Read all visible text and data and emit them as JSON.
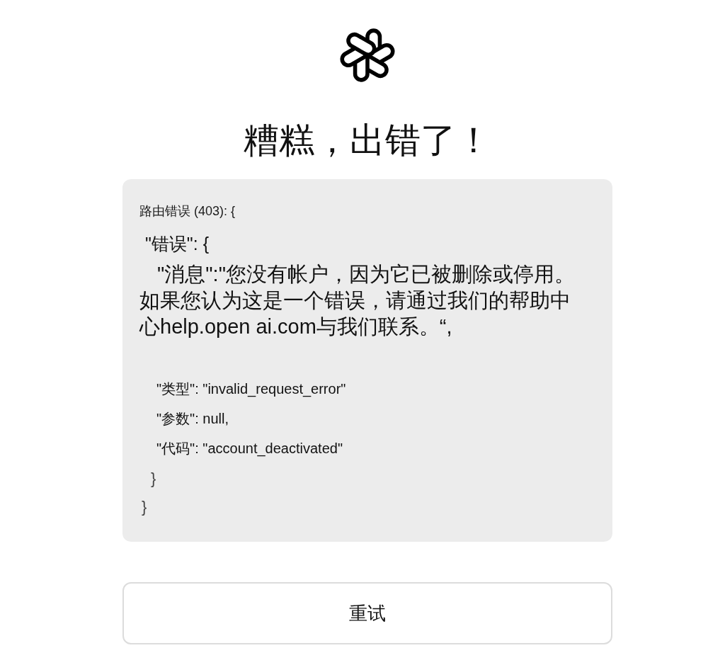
{
  "title": "糟糕，出错了！",
  "error_box": {
    "lines": [
      {
        "kind": "heading",
        "text": "路由错误 (403): {"
      },
      {
        "kind": "object_open",
        "text": "\"错误\": {"
      },
      {
        "kind": "message",
        "text": "\"消息\":\"您没有帐户，因为它已被删除或停用。如果您认为这是一个错误，请通过我们的帮助中心help.open ai.com与我们联系。“,"
      },
      {
        "kind": "field",
        "text": "\"类型\": \"invalid_request_error\""
      },
      {
        "kind": "field",
        "text": "\"参数\": null,"
      },
      {
        "kind": "field",
        "text": "\"代码\": \"account_deactivated\""
      },
      {
        "kind": "close_inner",
        "text": "}"
      },
      {
        "kind": "close_outer",
        "text": "}"
      }
    ]
  },
  "retry_button": {
    "label": "重试"
  }
}
